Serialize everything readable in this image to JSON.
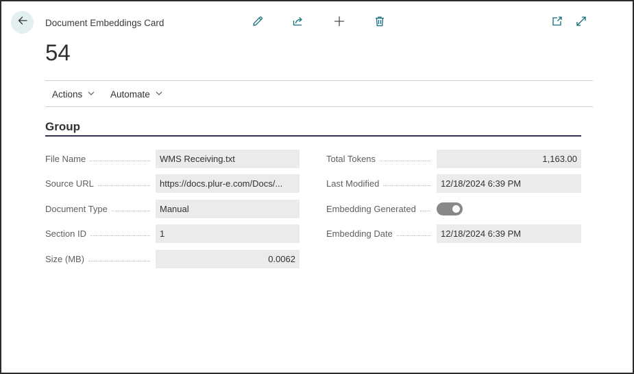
{
  "header": {
    "caption": "Document Embeddings Card",
    "record_title": "54"
  },
  "toolbar": {
    "icons": [
      "edit-icon",
      "share-icon",
      "add-icon",
      "delete-icon",
      "open-new-window-icon",
      "expand-icon"
    ]
  },
  "menu": {
    "actions_label": "Actions",
    "automate_label": "Automate"
  },
  "group": {
    "title": "Group",
    "left_fields": [
      {
        "label": "File Name",
        "value": "WMS Receiving.txt"
      },
      {
        "label": "Source URL",
        "value": "https://docs.plur-e.com/Docs/..."
      },
      {
        "label": "Document Type",
        "value": "Manual"
      },
      {
        "label": "Section ID",
        "value": "1"
      },
      {
        "label": "Size (MB)",
        "value": "0.0062"
      }
    ],
    "right_fields": [
      {
        "label": "Total Tokens",
        "value": "1,163.00"
      },
      {
        "label": "Last Modified",
        "value": "12/18/2024 6:39 PM"
      },
      {
        "label": "Embedding Generated",
        "value": true
      },
      {
        "label": "Embedding Date",
        "value": "12/18/2024 6:39 PM"
      }
    ]
  },
  "colors": {
    "accent": "#0f6b79",
    "back_button_bg": "#e3eef0",
    "field_bg": "#eaebeb",
    "group_underline": "#2f3350",
    "toggle_on": "#8a8886"
  }
}
